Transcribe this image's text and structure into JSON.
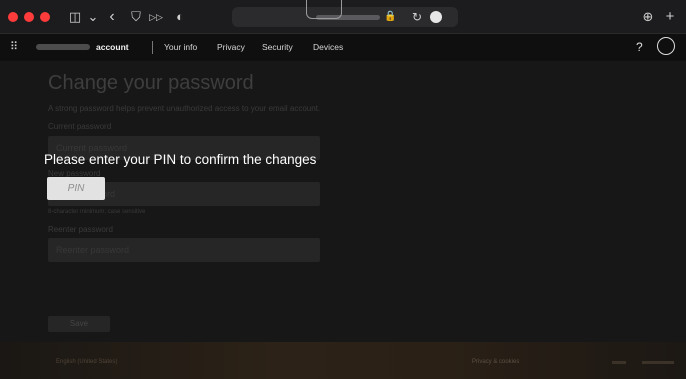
{
  "browser": {
    "icons": [
      "sidebar-icon",
      "chevron-down-icon",
      "back-icon",
      "shield-icon",
      "forward-icon",
      "privacy-icon",
      "lock-icon",
      "reload-icon",
      "extension-icon",
      "download-icon",
      "new-tab-icon"
    ],
    "glyphs": {
      "sidebar": "◫",
      "chevron_down": "⌄",
      "back": "‹",
      "shield": "⛉",
      "forward": "▷▷",
      "privacy": "◐",
      "lock": "🔒",
      "reload": "↻",
      "download": "⊕",
      "new_tab": "+"
    },
    "traffic_light_color": "#ff3b3b"
  },
  "nav": {
    "grid_glyph": "⠿",
    "account_label": "account",
    "items": [
      "Your info",
      "Privacy",
      "Security",
      "Devices"
    ],
    "help_label": "?"
  },
  "page": {
    "title": "Change your password",
    "lead": "A strong password helps prevent unauthorized access to your email account.",
    "current_label": "Current password",
    "current_placeholder": "Current password",
    "new_label": "New password",
    "new_placeholder": "New password",
    "hint": "8-character minimum; case sensitive",
    "reenter_label": "Reenter password",
    "reenter_placeholder": "Reenter password",
    "save_label": "Save"
  },
  "footer": {
    "language": "English (United States)",
    "privacy": "Privacy & cookies"
  },
  "pin_dialog": {
    "prompt": "Please enter your PIN to confirm the changes",
    "placeholder": "PIN"
  }
}
